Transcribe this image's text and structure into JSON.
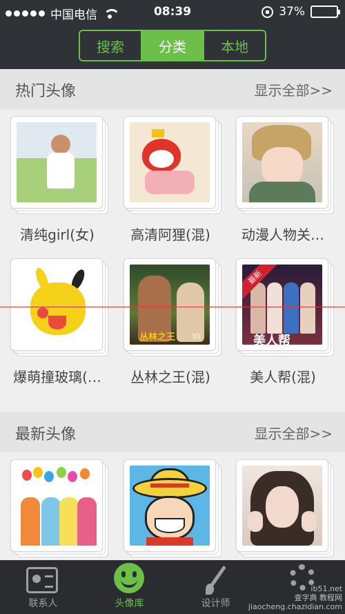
{
  "status_bar": {
    "carrier": "中国电信",
    "time": "08:39",
    "battery": "37%",
    "battery_level": 0.37
  },
  "segments": [
    {
      "label": "搜索",
      "active": false
    },
    {
      "label": "分类",
      "active": true
    },
    {
      "label": "本地",
      "active": false
    }
  ],
  "hot_section": {
    "title": "热门头像",
    "more": "显示全部>>",
    "items": [
      {
        "label": "清纯girl(女)"
      },
      {
        "label": "高清阿狸(混)"
      },
      {
        "label": "动漫人物关…"
      },
      {
        "label": "爆萌撞玻璃(…"
      },
      {
        "label": "丛林之王(混)"
      },
      {
        "label": "美人帮(混)"
      }
    ]
  },
  "new_section": {
    "title": "最新头像",
    "more": "显示全部>>"
  },
  "thumbnail_text": {
    "tarzan_logo": "丛林之王",
    "tarzan_3d": "3D",
    "meiren_ribbon": "最新",
    "meiren_title": "美人帮"
  },
  "tabbar": [
    {
      "label": "联系人",
      "icon": "contact-card-icon",
      "active": false
    },
    {
      "label": "头像库",
      "icon": "smiley-icon",
      "active": true
    },
    {
      "label": "设计师",
      "icon": "brush-icon",
      "active": false
    },
    {
      "label": "",
      "icon": "gear-icon",
      "active": false
    }
  ],
  "watermark": {
    "line1": "ib51.net",
    "line2": "查字典 教程网",
    "line3": "jiaocheng.chazidian.com"
  },
  "colors": {
    "accent": "#6cc04a",
    "header_bg": "#2f3236",
    "tabbar_bg": "#2a2c2f",
    "guide_line": "#e23b3b"
  }
}
